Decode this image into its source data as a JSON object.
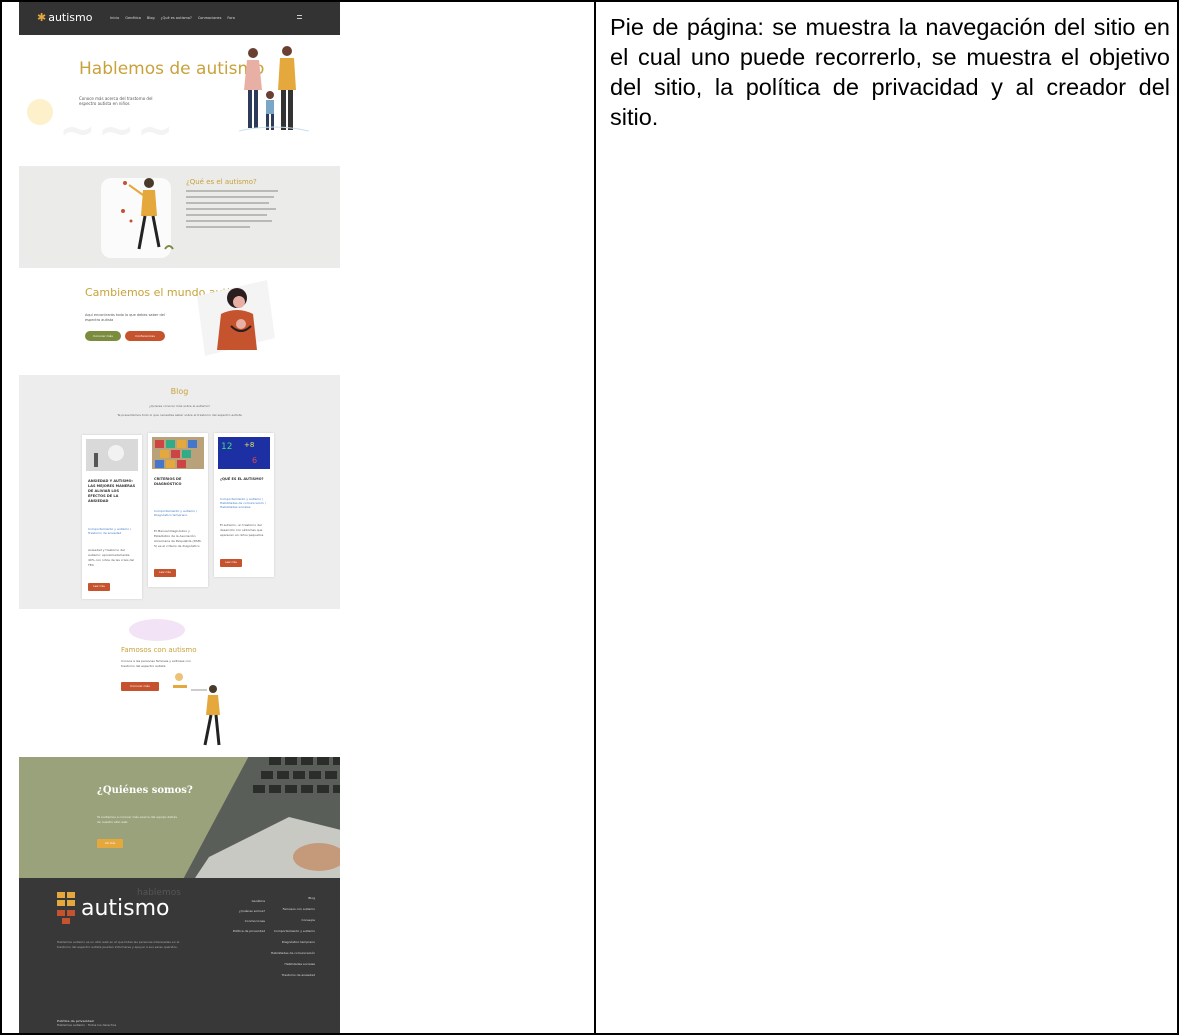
{
  "caption": "Pie de página: se muestra la navegación del sitio en el cual uno puede recorrerlo, se muestra el objetivo del sitio, la política de privacidad y al creador del sitio.",
  "screenshot": {
    "nav": {
      "logo": "autismo",
      "items": [
        "Inicio",
        "Genética",
        "Blog",
        "¿Qué es autismo?",
        "Conmociones",
        "Foro"
      ]
    },
    "hero": {
      "title": "Hablemos de autismo",
      "subtitle": "Conoce más acerca del trastorno del espectro autista en niños"
    },
    "what": {
      "title": "¿Qué es el autismo?"
    },
    "change": {
      "title": "Cambiemos el mundo autista",
      "subtitle": "Aquí encontrarás todo lo que debes saber del espectro autista",
      "button1": "Conocer más",
      "button2": "Conferencias"
    },
    "blog": {
      "title": "Blog",
      "subtitle": "¿Quieres conocer más sobre el autismo?",
      "subtitle2": "Te presentamos todo lo que necesitas saber sobre el trastorno del espectro autista",
      "cards": [
        {
          "heading": "ANSIEDAD Y AUTISMO: LAS MEJORES MANERAS DE ALIVIAR LOS EFECTOS DE LA ANSIEDAD",
          "meta": "Comportamiento y autismo / Trastorno de ansiedad",
          "text": "Ansiedad y trastorno del autismo: aproximadamente 40% con niños de las crisis del TEA",
          "button": "Leer más"
        },
        {
          "heading": "CRITERIOS DE DIAGNÓSTICO",
          "meta": "Comportamiento y autismo / Diagnóstico temprano",
          "text": "El Manual Diagnóstico y Estadístico de la Asociación Americana de Psiquiatría (DSM-5) es el criterio de diagnóstico",
          "button": "Leer más"
        },
        {
          "heading": "¿QUÉ ES EL AUTISMO?",
          "meta": "Comportamiento y autismo / Habilidades de comunicación / Habilidades sociales",
          "text": "El autismo, un trastorno del desarrollo con síntomas que aparecen en niños pequeños",
          "button": "Leer más"
        }
      ]
    },
    "famous": {
      "title": "Famosos con autismo",
      "subtitle": "Conoce a las personas famosas y exitosas con trastorno del espectro autista",
      "button": "Conocer más"
    },
    "who": {
      "title": "¿Quiénes somos?",
      "subtitle": "Te invitamos a conocer más acerca del equipo detrás de nuestro sitio web",
      "button": "Ver más"
    },
    "footer": {
      "logo_small": "hablemos",
      "logo": "autismo",
      "description": "Hablemos autismo es un sitio web en el que todas las personas interesadas en el trastorno del espectro autista pueden informarse y apoyar a sus seres queridos.",
      "col1": [
        "Genética",
        "¿Quiénes somos?",
        "Conmociones",
        "Política de privacidad"
      ],
      "col2": [
        "Blog",
        "Famosos con autismo",
        "Consejos",
        "Comportamiento y autismo",
        "Diagnóstico temprano",
        "Habilidades de comunicación",
        "Habilidades sociales",
        "Trastorno de ansiedad"
      ],
      "policy_title": "Política de privacidad",
      "policy_sub": "Hablemos autismo · Todos los derechos"
    }
  }
}
